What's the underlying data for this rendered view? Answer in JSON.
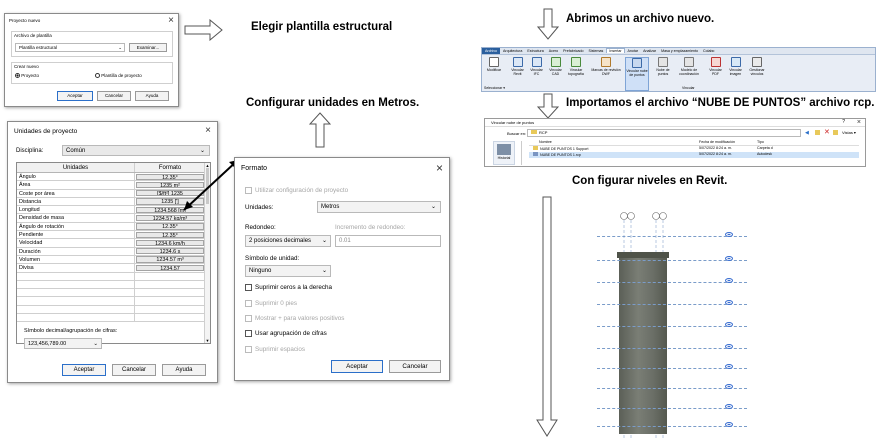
{
  "captions": {
    "choose_template": "Elegir plantilla estructural",
    "open_new": "Abrimos un archivo nuevo.",
    "import_file": "Importamos el archivo “NUBE DE PUNTOS” archivo rcp.",
    "configure_units": "Configurar unidades en Metros.",
    "configure_levels": "Con figurar niveles en Revit."
  },
  "new_project": {
    "title": "Proyecto nuevo",
    "template_group": "Archivo de plantilla",
    "template_value": "Plantilla estructural",
    "browse": "Examinar...",
    "create_group": "Crear nuevo",
    "opt_project": "Proyecto",
    "opt_template": "Plantilla de proyecto",
    "ok": "Aceptar",
    "cancel": "Cancelar",
    "help": "Ayuda"
  },
  "ribbon": {
    "tabs": [
      "Archivo",
      "Arquitectura",
      "Estructura",
      "Acero",
      "Prefabricado",
      "Sistemas",
      "Insertar",
      "Anotar",
      "Analizar",
      "Masa y emplazamiento",
      "Colabo"
    ],
    "active_tab": "Insertar",
    "buttons": [
      "Modificar",
      "Vincular Revit",
      "Vincular IFC",
      "Vincular CAD",
      "Vincular topografía",
      "Marcas de revisión DWF",
      "Vincular nube de puntos",
      "Nube de puntos",
      "Modelo de coordinación",
      "Vincular PDF",
      "Vincular imagen",
      "Gestionar vínculos"
    ],
    "panel_select": "Seleccionar ▾",
    "panel_link": "Vincular"
  },
  "file_dialog": {
    "title": "Vincular nube de puntos",
    "look_in_label": "Buscar en:",
    "look_in_value": "RCP",
    "view_label": "Vistas ▾",
    "col_name": "Nombre",
    "col_date": "Fecha de modificación",
    "col_type": "Tipo",
    "rows": [
      {
        "name": "NUBE DE PUNTOS 1 Support",
        "date": "5/07/2022 8:24 a. m.",
        "type": "Carpeta d"
      },
      {
        "name": "NUBE DE PUNTOS 1.rcp",
        "date": "5/07/2022 8:24 a. m.",
        "type": "Autodesk"
      }
    ],
    "sidebar_label": "Historial"
  },
  "units_dialog": {
    "title": "Unidades de proyecto",
    "discipline_label": "Disciplina:",
    "discipline_value": "Común",
    "col_units": "Unidades",
    "col_format": "Formato",
    "rows": [
      {
        "name": "Ángulo",
        "format": "12.35°"
      },
      {
        "name": "Área",
        "format": "1235 m²"
      },
      {
        "name": "Coste por área",
        "format": "[$/ft²] 1235"
      },
      {
        "name": "Distancia",
        "format": "1235 [']"
      },
      {
        "name": "Longitud",
        "format": "1234.568 [m]"
      },
      {
        "name": "Densidad de masa",
        "format": "1234.57 kg/m³"
      },
      {
        "name": "Ángulo de rotación",
        "format": "12.35°"
      },
      {
        "name": "Pendiente",
        "format": "12.35°"
      },
      {
        "name": "Velocidad",
        "format": "1234.6 km/h"
      },
      {
        "name": "Duración",
        "format": "1234.6 s"
      },
      {
        "name": "Volumen",
        "format": "1234.57 m³"
      },
      {
        "name": "Divisa",
        "format": "1234.57"
      }
    ],
    "decimal_label": "Símbolo decimal/agrupación de cifras:",
    "decimal_value": "123,456,789.00",
    "ok": "Aceptar",
    "cancel": "Cancelar",
    "help": "Ayuda"
  },
  "format_dialog": {
    "title": "Formato",
    "use_project": "Utilizar configuración de proyecto",
    "units_label": "Unidades:",
    "units_value": "Metros",
    "rounding_label": "Redondeo:",
    "rounding_value": "2 posiciones decimales",
    "increment_label": "Incremento de redondeo:",
    "increment_value": "0.01",
    "symbol_label": "Símbolo de unidad:",
    "symbol_value": "Ninguno",
    "opt_suppress_zeros": "Suprimir ceros a la derecha",
    "opt_suppress_feet": "Suprimir 0 pies",
    "opt_plus": "Mostrar + para valores positivos",
    "opt_grouping": "Usar agrupación de cifras",
    "opt_spaces": "Suprimir espacios",
    "ok": "Aceptar",
    "cancel": "Cancelar"
  },
  "colors": {
    "ribbon_tab_active": "#ffffff",
    "ribbon_bg": "#e8edf5",
    "ribbon_tab_bar": "#2a5f9e",
    "building": "#6b6f67"
  }
}
